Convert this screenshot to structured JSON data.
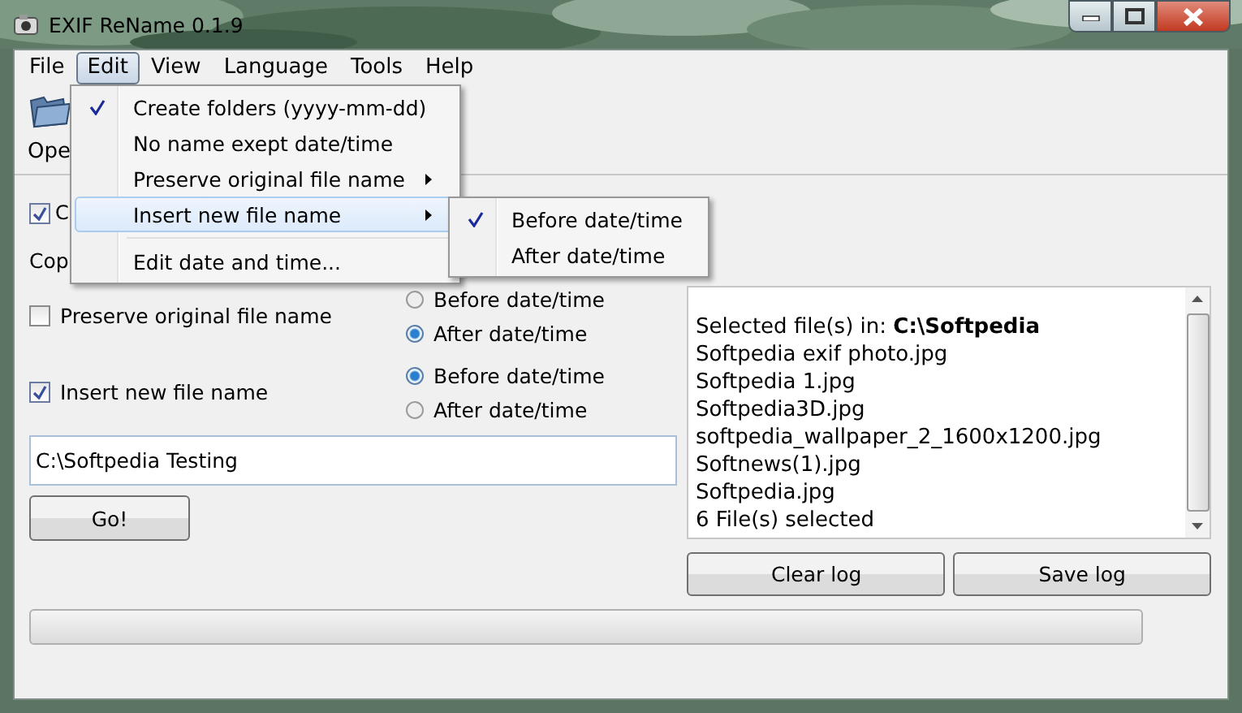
{
  "window": {
    "title": "EXIF ReName 0.1.9"
  },
  "menu_bar": [
    {
      "label": "File",
      "selected": false
    },
    {
      "label": "Edit",
      "selected": true
    },
    {
      "label": "View",
      "selected": false
    },
    {
      "label": "Language",
      "selected": false
    },
    {
      "label": "Tools",
      "selected": false
    },
    {
      "label": "Help",
      "selected": false
    }
  ],
  "toolbar": {
    "open_label": "Ope"
  },
  "options": {
    "create_checkbox": {
      "label": "C",
      "checked": true
    },
    "copy_label": "Cop",
    "preserve": {
      "label": "Preserve original file name",
      "checked": false,
      "radios": [
        {
          "label": "Before date/time",
          "selected": false
        },
        {
          "label": "After date/time",
          "selected": true
        }
      ]
    },
    "insert": {
      "label": "Insert new file name",
      "checked": true,
      "radios": [
        {
          "label": "Before date/time",
          "selected": true
        },
        {
          "label": "After date/time",
          "selected": false
        }
      ]
    }
  },
  "folder_field": {
    "value": "C:\\Softpedia Testing"
  },
  "go_button": "Go!",
  "log": {
    "heading": "Selected file(s) in: **C:\\Softpedia**",
    "lines": [
      "Softpedia exif photo.jpg",
      "Softpedia 1.jpg",
      "Softpedia3D.jpg",
      "softpedia_wallpaper_2_1600x1200.jpg",
      "Softnews(1).jpg",
      "Softpedia.jpg",
      "6 File(s) selected"
    ]
  },
  "log_buttons": [
    "Clear log",
    "Save log"
  ],
  "progress": {
    "level": 0
  },
  "edit_menu": [
    {
      "kind": "item",
      "label": "Create folders (yyyy-mm-dd)",
      "checked": true,
      "selected": false,
      "has_submenu": false
    },
    {
      "kind": "item",
      "label": "No name exept date/time",
      "checked": false,
      "selected": false,
      "has_submenu": false
    },
    {
      "kind": "item",
      "label": "Preserve original file name",
      "checked": false,
      "selected": false,
      "has_submenu": true
    },
    {
      "kind": "item",
      "label": "Insert new file name",
      "checked": false,
      "selected": true,
      "has_submenu": true
    },
    {
      "kind": "separator"
    },
    {
      "kind": "item",
      "label": "Edit date and time...",
      "checked": false,
      "selected": false,
      "has_submenu": false
    }
  ],
  "submenu": [
    {
      "label": "Before date/time",
      "checked": true
    },
    {
      "label": "After date/time",
      "checked": false
    }
  ]
}
